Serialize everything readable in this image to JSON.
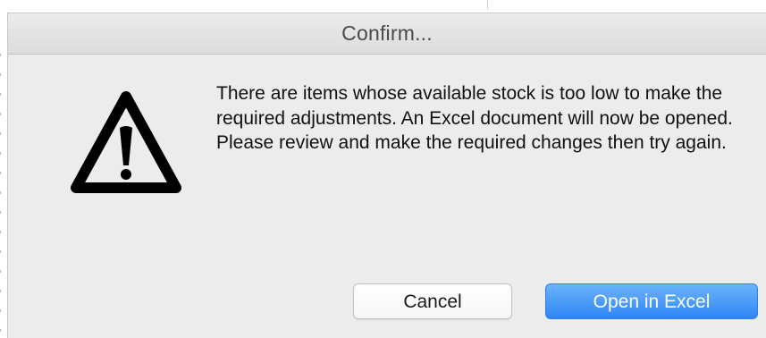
{
  "dialog": {
    "title": "Confirm...",
    "icon": "warning-triangle-icon",
    "message": "There are items whose available stock is too low to make the required adjustments. An Excel document will now be opened. Please review and make the required changes then try again.",
    "buttons": {
      "cancel_label": "Cancel",
      "primary_label": "Open in Excel"
    }
  },
  "colors": {
    "primary_button": "#2f86f6",
    "dialog_background": "#ececec"
  }
}
